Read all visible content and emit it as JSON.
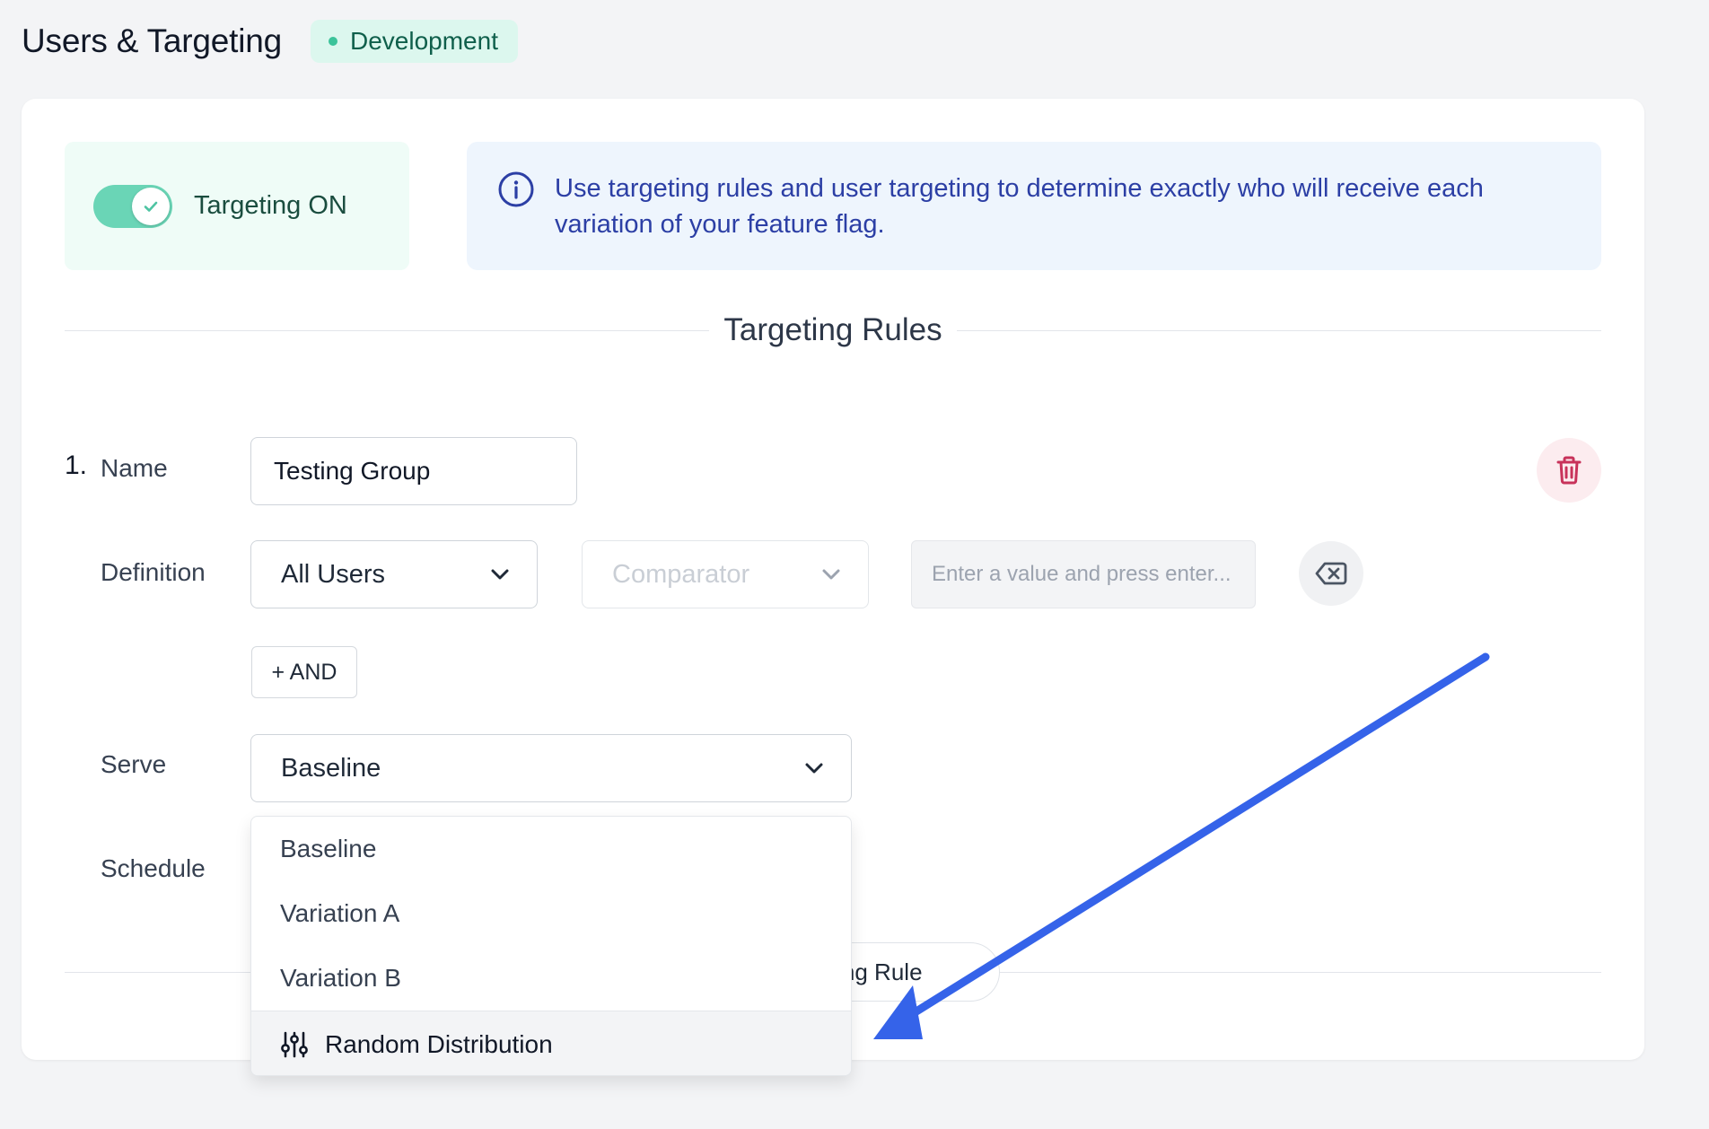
{
  "header": {
    "title": "Users & Targeting",
    "environment_badge": "Development"
  },
  "toggle": {
    "label": "Targeting ON",
    "state": "on"
  },
  "info": {
    "text": "Use targeting rules and user targeting to determine exactly who will receive each variation of your feature flag."
  },
  "section": {
    "title": "Targeting Rules"
  },
  "rule": {
    "number": "1.",
    "name_label": "Name",
    "name_value": "Testing Group",
    "definition_label": "Definition",
    "definition_select": "All Users",
    "comparator_placeholder": "Comparator",
    "value_placeholder": "Enter a value and press enter...",
    "and_button": "+ AND",
    "serve_label": "Serve",
    "serve_select": "Baseline",
    "schedule_label": "Schedule"
  },
  "add_rule_button": "eting Rule",
  "dropdown": {
    "options": [
      "Baseline",
      "Variation A",
      "Variation B"
    ],
    "highlighted_option": "Random Distribution"
  },
  "colors": {
    "accent_green": "#6ad5b6",
    "info_blue": "#2c3fa5",
    "arrow_blue": "#3563e9",
    "delete_red": "#c8325a"
  }
}
